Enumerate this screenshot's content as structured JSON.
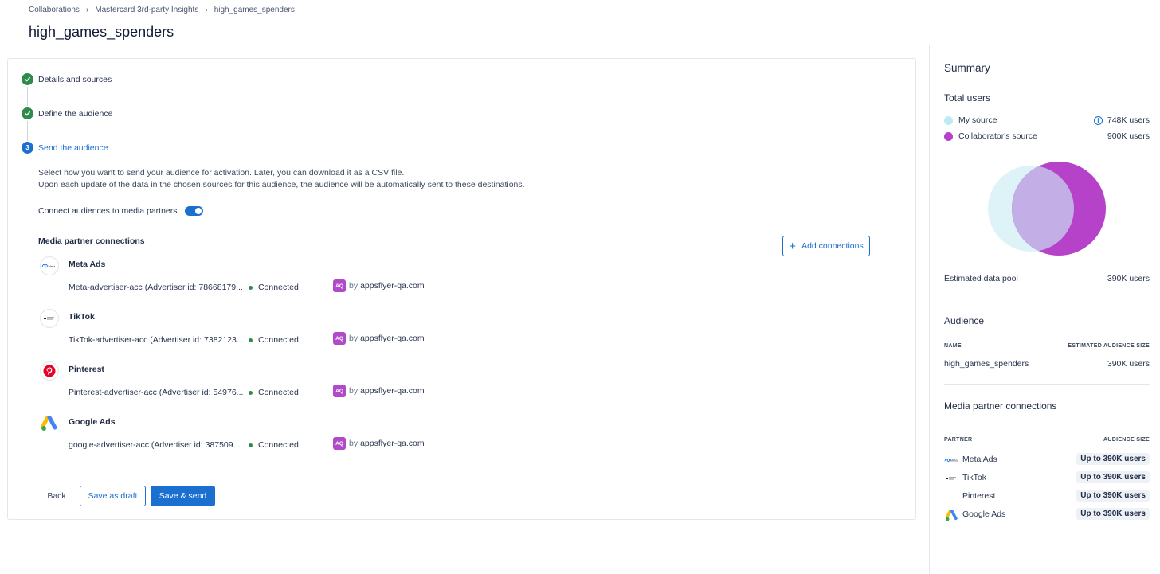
{
  "breadcrumb": [
    "Collaborations",
    "Mastercard 3rd-party Insights",
    "high_games_spenders"
  ],
  "page_title": "high_games_spenders",
  "steps": [
    {
      "label": "Details and sources",
      "state": "done"
    },
    {
      "label": "Define the audience",
      "state": "done"
    },
    {
      "label": "Send the audience",
      "state": "active",
      "number": "3"
    }
  ],
  "description": {
    "line1": "Select how you want to send your audience for activation. Later, you can download it as a CSV file.",
    "line2": "Upon each update of the data in the chosen sources for this audience, the audience will be automatically sent to these destinations."
  },
  "toggle": {
    "label": "Connect audiences to media partners",
    "on": true
  },
  "media_section": {
    "title": "Media partner connections",
    "add_label": "Add connections",
    "partners": [
      {
        "name": "Meta Ads",
        "account": "Meta-advertiser-acc (Advertiser id: 78668179...",
        "status": "Connected",
        "avatar": "AQ",
        "by": "by",
        "owner": "appsflyer-qa.com",
        "logo_text": "Meta"
      },
      {
        "name": "TikTok",
        "account": "TikTok-advertiser-acc (Advertiser id: 7382123...",
        "status": "Connected",
        "avatar": "AQ",
        "by": "by",
        "owner": "appsflyer-qa.com"
      },
      {
        "name": "Pinterest",
        "account": "Pinterest-advertiser-acc (Advertiser id: 54976...",
        "status": "Connected",
        "avatar": "AQ",
        "by": "by",
        "owner": "appsflyer-qa.com"
      },
      {
        "name": "Google Ads",
        "account": "google-advertiser-acc (Advertiser id: 387509...",
        "status": "Connected",
        "avatar": "AQ",
        "by": "by",
        "owner": "appsflyer-qa.com"
      }
    ]
  },
  "actions": {
    "back": "Back",
    "draft": "Save as draft",
    "send": "Save & send"
  },
  "summary": {
    "title": "Summary",
    "total_users_title": "Total users",
    "my_source": {
      "label": "My source",
      "value": "748K users",
      "color": "#bdeaf5"
    },
    "collab_source": {
      "label": "Collaborator's source",
      "value": "900K users",
      "color": "#b542c9"
    },
    "pool": {
      "label": "Estimated data pool",
      "value": "390K users"
    },
    "audience": {
      "title": "Audience",
      "col_name": "NAME",
      "col_size": "ESTIMATED AUDIENCE SIZE",
      "name": "high_games_spenders",
      "size": "390K users"
    },
    "media": {
      "title": "Media partner connections",
      "col_partner": "PARTNER",
      "col_size": "AUDIENCE SIZE",
      "rows": [
        {
          "name": "Meta Ads",
          "size": "Up to 390K users"
        },
        {
          "name": "TikTok",
          "size": "Up to 390K users"
        },
        {
          "name": "Pinterest",
          "size": "Up to 390K users"
        },
        {
          "name": "Google Ads",
          "size": "Up to 390K users"
        }
      ]
    }
  },
  "colors": {
    "accent": "#1b6fd1",
    "success": "#2e8b4c",
    "avatar": "#b04ac9"
  }
}
